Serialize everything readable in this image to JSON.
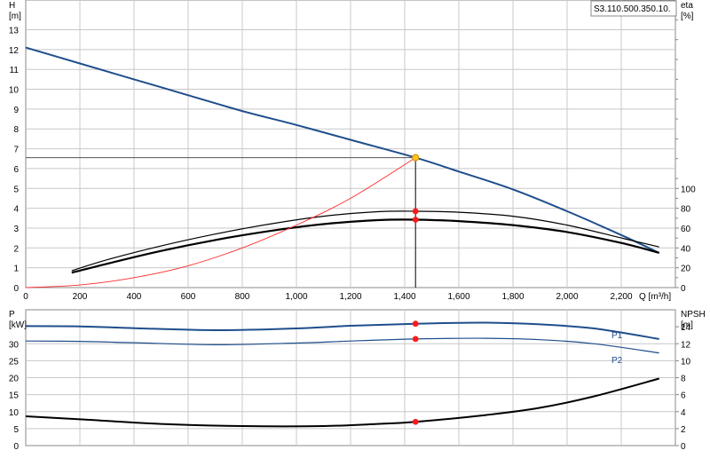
{
  "model_label": "S3.110.500.350.10.",
  "chart_data": [
    {
      "type": "line",
      "panel": "head-efficiency",
      "xlabel": "Q [m³/h]",
      "xlim": [
        0,
        2400
      ],
      "x_ticks": [
        0,
        200,
        400,
        600,
        800,
        1000,
        1200,
        1400,
        1600,
        1800,
        2000,
        2200
      ],
      "x_tick_labels": [
        "0",
        "200",
        "400",
        "600",
        "800",
        "1,000",
        "1,200",
        "1,400",
        "1,600",
        "1,800",
        "2,000",
        "2,200"
      ],
      "left_axis": {
        "label": "H",
        "unit": "[m]",
        "ylim": [
          0,
          14.5
        ],
        "ticks": [
          0,
          1,
          2,
          3,
          4,
          5,
          6,
          7,
          8,
          9,
          10,
          11,
          12,
          13
        ]
      },
      "right_axis": {
        "label": "eta",
        "unit": "[%]",
        "ylim": [
          0,
          0
        ],
        "ticks": [
          0,
          20,
          40,
          60,
          80,
          100
        ]
      },
      "grid": true,
      "series": [
        {
          "name": "",
          "axis": "left",
          "color": "#1f4e8c",
          "width": 2,
          "x": [
            0,
            200,
            400,
            600,
            800,
            1000,
            1200,
            1440,
            1600,
            1800,
            2000,
            2200,
            2340
          ],
          "y": [
            12.1,
            11.3,
            10.5,
            9.7,
            8.9,
            8.2,
            7.45,
            6.55,
            5.85,
            4.95,
            3.85,
            2.65,
            1.75
          ]
        },
        {
          "name": "",
          "axis": "right",
          "color": "#000000",
          "width": 1.2,
          "x": [
            170,
            300,
            500,
            700,
            900,
            1100,
            1300,
            1440,
            1600,
            1800,
            2000,
            2200,
            2340
          ],
          "y": [
            17,
            28,
            42,
            54,
            64,
            72,
            76.5,
            77,
            76,
            72,
            63,
            50,
            41
          ]
        },
        {
          "name": "",
          "axis": "right",
          "color": "#000000",
          "width": 2.2,
          "x": [
            170,
            300,
            500,
            700,
            900,
            1100,
            1300,
            1440,
            1600,
            1800,
            2000,
            2200,
            2340
          ],
          "y": [
            15,
            24,
            37,
            48,
            57,
            64,
            68,
            68.5,
            67,
            63,
            56,
            45,
            35
          ]
        },
        {
          "name": "",
          "axis": "left",
          "color": "#ff2a2a",
          "width": 0.9,
          "x": [
            0,
            200,
            400,
            600,
            800,
            1000,
            1200,
            1440
          ],
          "y": [
            0,
            0.13,
            0.5,
            1.1,
            2.0,
            3.15,
            4.5,
            6.55
          ]
        }
      ],
      "duty_point": {
        "q": 1440,
        "h": 6.55,
        "eta_upper": 77,
        "eta_lower": 68.5
      }
    },
    {
      "type": "line",
      "panel": "power-npsh",
      "xlim": [
        0,
        2400
      ],
      "left_axis": {
        "label": "P",
        "unit": "[kW]",
        "ylim": [
          0,
          40
        ],
        "ticks": [
          0,
          5,
          10,
          15,
          20,
          25,
          30
        ]
      },
      "right_axis": {
        "label": "NPSH",
        "unit": "[m]",
        "ylim": [
          0,
          16
        ],
        "ticks": [
          0,
          2,
          4,
          6,
          8,
          10,
          12,
          14
        ]
      },
      "grid": true,
      "series": [
        {
          "name": "P1",
          "axis": "left",
          "color": "#1f4e8c",
          "width": 2,
          "x": [
            0,
            200,
            400,
            700,
            1000,
            1200,
            1440,
            1700,
            1900,
            2100,
            2340
          ],
          "y": [
            35.2,
            35.1,
            34.6,
            34.0,
            34.5,
            35.3,
            35.9,
            36.2,
            35.7,
            34.5,
            31.4
          ]
        },
        {
          "name": "P2",
          "axis": "left",
          "color": "#1f4e8c",
          "width": 1.2,
          "x": [
            0,
            200,
            400,
            700,
            1000,
            1200,
            1440,
            1700,
            1900,
            2100,
            2340
          ],
          "y": [
            30.8,
            30.7,
            30.3,
            29.7,
            30.2,
            30.8,
            31.4,
            31.6,
            31.2,
            30.0,
            27.3
          ]
        },
        {
          "name": "",
          "axis": "right",
          "color": "#000000",
          "width": 2,
          "x": [
            0,
            200,
            500,
            800,
            1100,
            1300,
            1440,
            1700,
            1900,
            2100,
            2340
          ],
          "y": [
            3.45,
            3.1,
            2.55,
            2.3,
            2.3,
            2.55,
            2.8,
            3.6,
            4.45,
            5.8,
            7.9
          ]
        }
      ],
      "duty_point": {
        "q": 1440,
        "p1": 35.9,
        "p2": 31.4,
        "npsh": 2.8
      }
    }
  ]
}
